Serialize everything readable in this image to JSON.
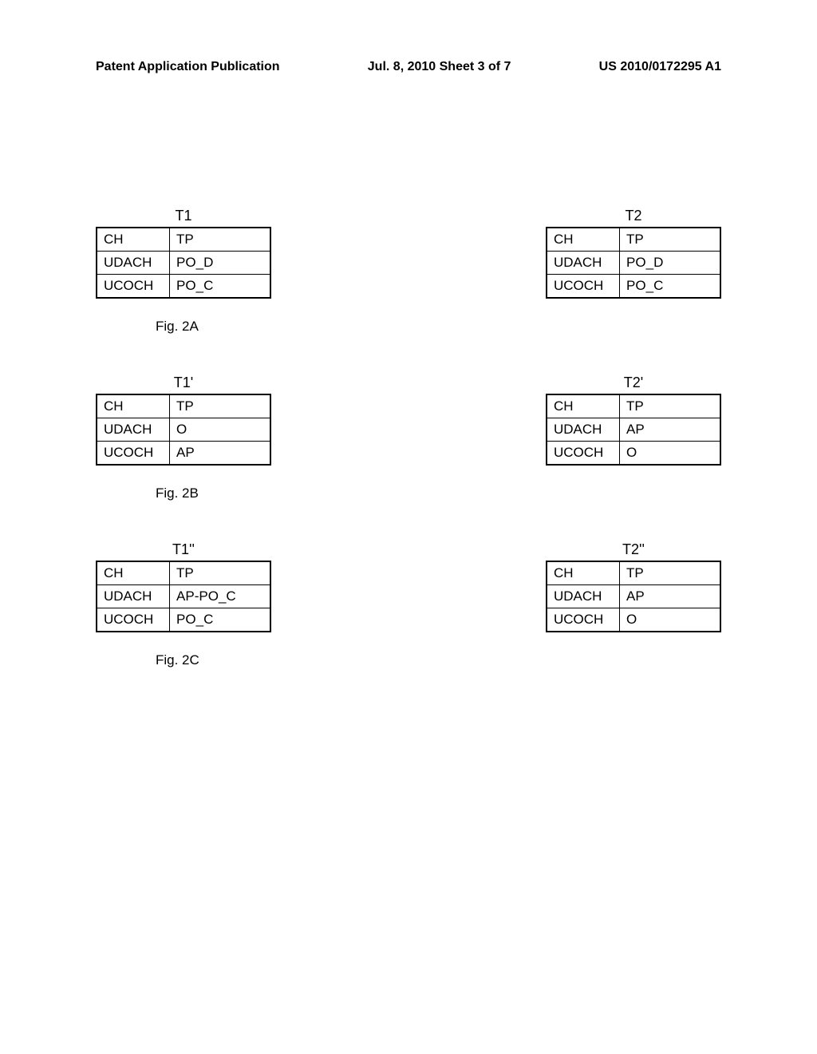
{
  "header": {
    "left": "Patent Application Publication",
    "center": "Jul. 8, 2010  Sheet 3 of 7",
    "right": "US 2010/0172295 A1"
  },
  "figures": [
    {
      "left": {
        "title": "T1",
        "rows": [
          [
            "CH",
            "TP"
          ],
          [
            "UDACH",
            "PO_D"
          ],
          [
            "UCOCH",
            "PO_C"
          ]
        ]
      },
      "right": {
        "title": "T2",
        "rows": [
          [
            "CH",
            "TP"
          ],
          [
            "UDACH",
            "PO_D"
          ],
          [
            "UCOCH",
            "PO_C"
          ]
        ]
      },
      "caption": "Fig. 2A"
    },
    {
      "left": {
        "title": "T1'",
        "rows": [
          [
            "CH",
            "TP"
          ],
          [
            "UDACH",
            "O"
          ],
          [
            "UCOCH",
            "AP"
          ]
        ]
      },
      "right": {
        "title": "T2'",
        "rows": [
          [
            "CH",
            "TP"
          ],
          [
            "UDACH",
            "AP"
          ],
          [
            "UCOCH",
            "O"
          ]
        ]
      },
      "caption": "Fig. 2B"
    },
    {
      "left": {
        "title": "T1''",
        "rows": [
          [
            "CH",
            "TP"
          ],
          [
            "UDACH",
            "AP-PO_C"
          ],
          [
            "UCOCH",
            "PO_C"
          ]
        ]
      },
      "right": {
        "title": "T2''",
        "rows": [
          [
            "CH",
            "TP"
          ],
          [
            "UDACH",
            "AP"
          ],
          [
            "UCOCH",
            "O"
          ]
        ]
      },
      "caption": "Fig. 2C"
    }
  ]
}
